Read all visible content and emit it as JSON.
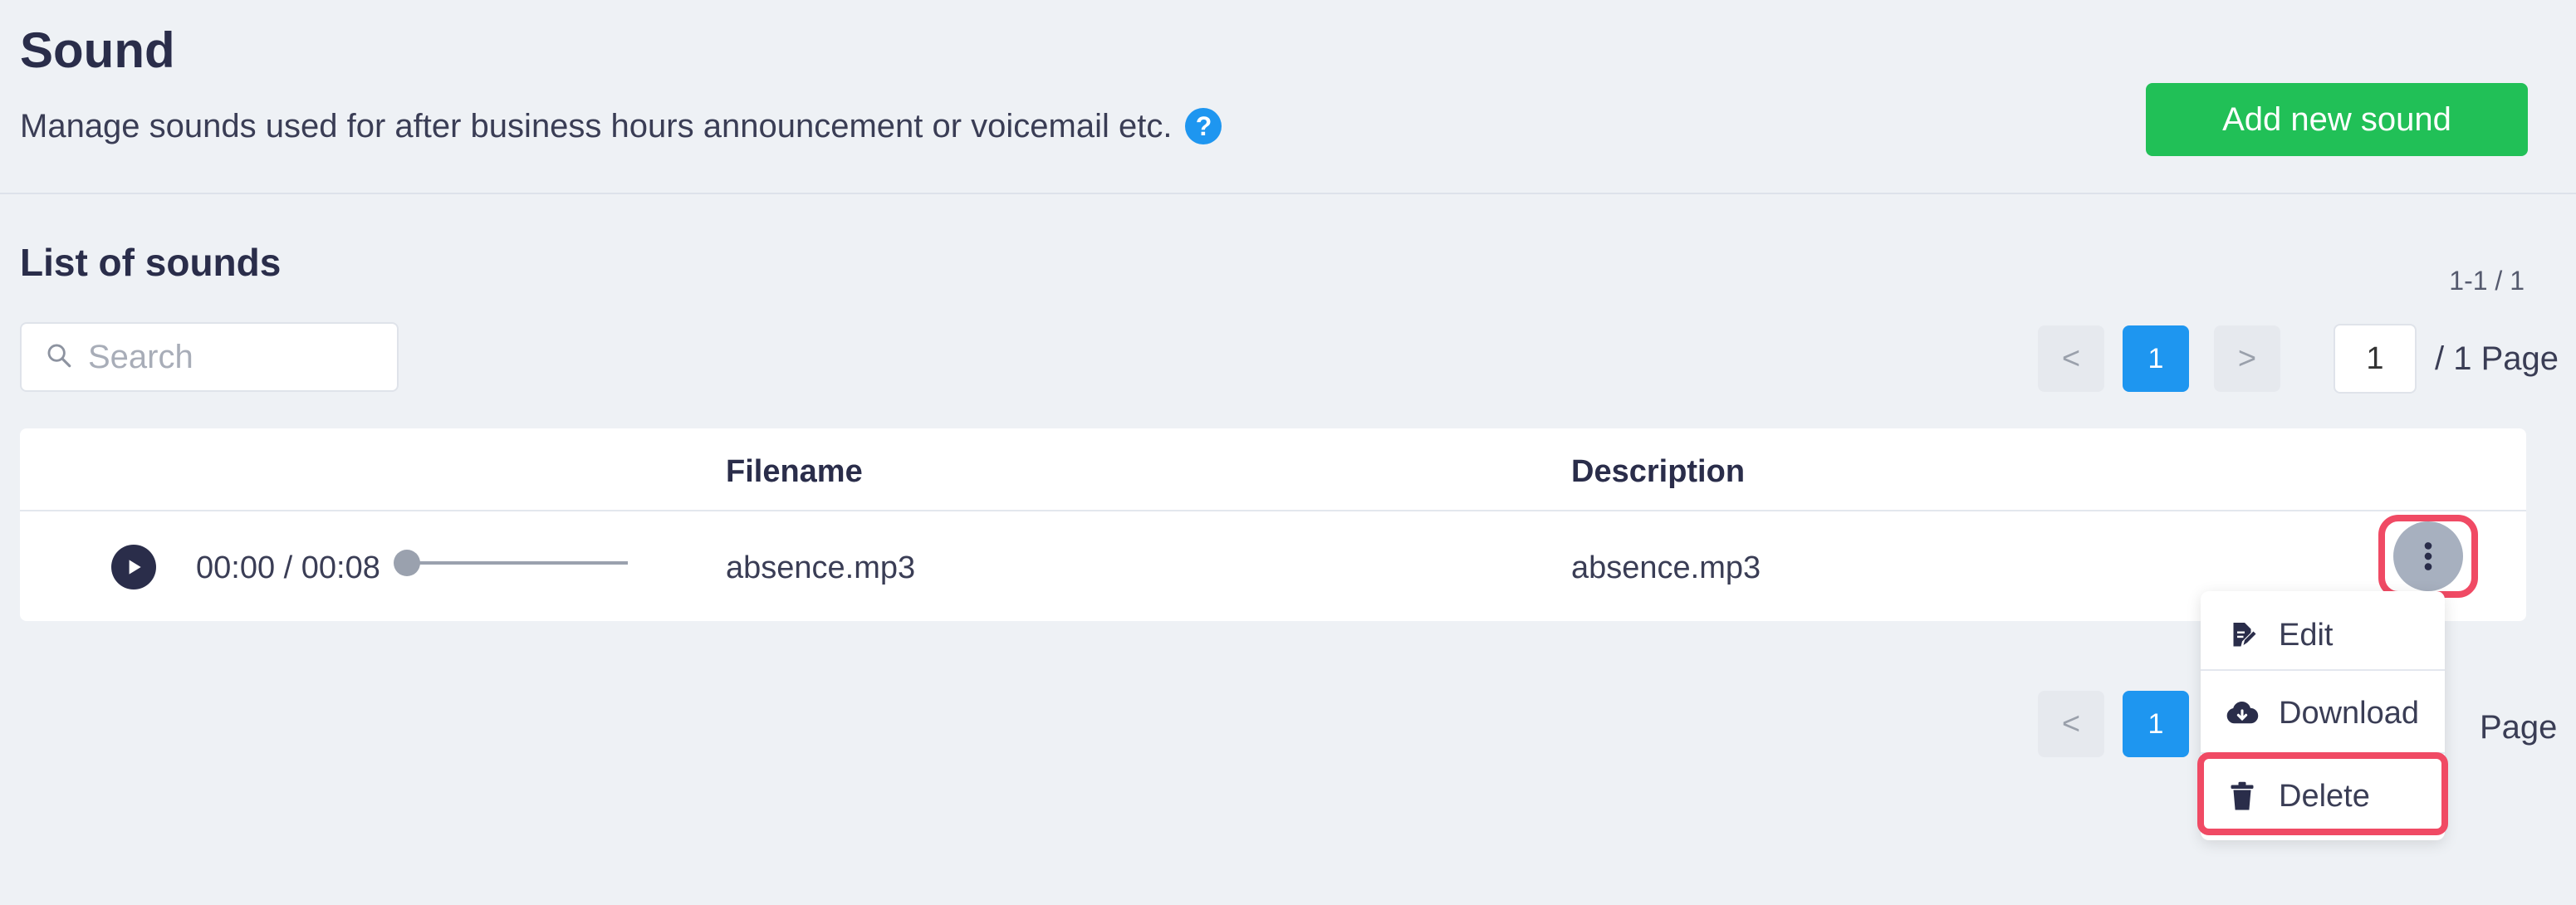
{
  "header": {
    "title": "Sound",
    "subtitle": "Manage sounds used for after business hours announcement or voicemail etc.",
    "help_icon": "?",
    "add_button_label": "Add new sound"
  },
  "list": {
    "title": "List of sounds",
    "range_info": "1-1 / 1",
    "search_placeholder": "Search",
    "pagination_top": {
      "prev": "<",
      "current": "1",
      "next": ">",
      "page_input_value": "1",
      "page_suffix": "/ 1 Page"
    },
    "pagination_bottom": {
      "prev": "<",
      "current": "1",
      "page_suffix_visible": "Page"
    }
  },
  "table": {
    "columns": [
      "",
      "Filename",
      "Description"
    ],
    "rows": [
      {
        "player_time": "00:00 / 00:08",
        "progress": 0,
        "filename": "absence.mp3",
        "description": "absence.mp3"
      }
    ]
  },
  "row_menu": {
    "items": [
      {
        "label": "Edit",
        "icon": "edit-icon"
      },
      {
        "label": "Download",
        "icon": "cloud-download-icon"
      },
      {
        "label": "Delete",
        "icon": "trash-icon"
      }
    ]
  },
  "colors": {
    "accent": "#1e96f0",
    "add_button": "#21c057",
    "highlight": "#f04a64",
    "background": "#eef1f5"
  }
}
